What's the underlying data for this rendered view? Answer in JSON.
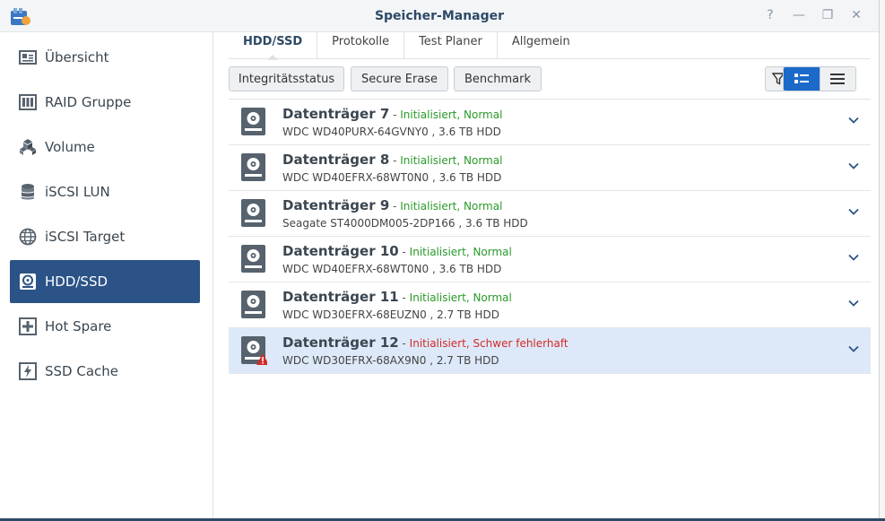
{
  "window": {
    "title": "Speicher-Manager",
    "controls": [
      "?",
      "—",
      "❐",
      "✕"
    ]
  },
  "sidebar": {
    "items": [
      {
        "label": "Übersicht",
        "icon": "overview-icon"
      },
      {
        "label": "RAID Gruppe",
        "icon": "raid-group-icon"
      },
      {
        "label": "Volume",
        "icon": "volume-cubes-icon"
      },
      {
        "label": "iSCSI LUN",
        "icon": "iscsi-lun-database-icon"
      },
      {
        "label": "iSCSI Target",
        "icon": "iscsi-target-globe-icon"
      },
      {
        "label": "HDD/SSD",
        "icon": "hdd-icon",
        "active": true
      },
      {
        "label": "Hot Spare",
        "icon": "hot-spare-plus-icon"
      },
      {
        "label": "SSD Cache",
        "icon": "ssd-cache-lightning-icon"
      }
    ]
  },
  "tabs": [
    "HDD/SSD",
    "Protokolle",
    "Test Planer",
    "Allgemein"
  ],
  "toolbar": {
    "integrity": "Integritätsstatus",
    "secure_erase": "Secure Erase",
    "benchmark": "Benchmark"
  },
  "colors": {
    "accent": "#2b5387",
    "ok": "#2a9a2a",
    "error": "#d42a2a",
    "selected_row": "#dde9f8"
  },
  "disks": [
    {
      "name": "Datenträger 7",
      "sep": " - ",
      "status": "Initialisiert, Normal",
      "state": "ok",
      "model": "WDC WD40PURX-64GVNY0 , 3.6 TB HDD"
    },
    {
      "name": "Datenträger 8",
      "sep": " - ",
      "status": "Initialisiert, Normal",
      "state": "ok",
      "model": "WDC WD40EFRX-68WT0N0 , 3.6 TB HDD"
    },
    {
      "name": "Datenträger 9",
      "sep": " - ",
      "status": "Initialisiert, Normal",
      "state": "ok",
      "model": "Seagate ST4000DM005-2DP166 , 3.6 TB HDD"
    },
    {
      "name": "Datenträger 10",
      "sep": " - ",
      "status": "Initialisiert, Normal",
      "state": "ok",
      "model": "WDC WD40EFRX-68WT0N0 , 3.6 TB HDD"
    },
    {
      "name": "Datenträger 11",
      "sep": " - ",
      "status": "Initialisiert, Normal",
      "state": "ok",
      "model": "WDC WD30EFRX-68EUZN0 , 2.7 TB HDD"
    },
    {
      "name": "Datenträger 12",
      "sep": " - ",
      "status": "Initialisiert, Schwer fehlerhaft",
      "state": "bad",
      "model": "WDC WD30EFRX-68AX9N0 , 2.7 TB HDD",
      "selected": true
    }
  ]
}
